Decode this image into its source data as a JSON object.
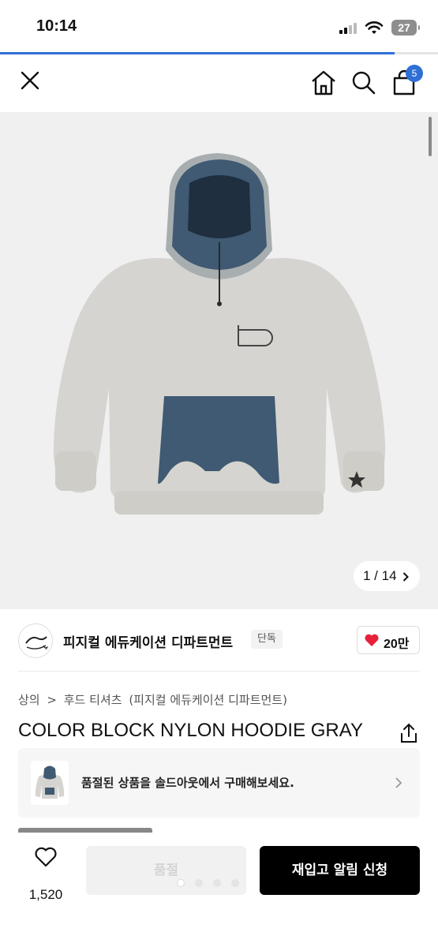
{
  "status": {
    "time": "10:14",
    "battery": "27"
  },
  "nav": {
    "cart_count": "5",
    "icons": [
      "close-icon",
      "home-icon",
      "search-icon",
      "cart-icon"
    ]
  },
  "page_progress": 0.9,
  "gallery": {
    "counter": "1 / 14"
  },
  "brand": {
    "name": "피지컬 에듀케이션 디파트먼트",
    "tag": "단독",
    "likes": "20만"
  },
  "breadcrumb": [
    "상의",
    ">",
    "후드 티셔츠",
    "(피지컬 에듀케이션 디파트먼트)"
  ],
  "product": {
    "title": "COLOR BLOCK NYLON HOODIE GRAY"
  },
  "soldout_card": {
    "text": "품절된 상품을 솔드아웃에서 구매해보세요."
  },
  "bottom": {
    "wish_count": "1,520",
    "soldout_label": "품절",
    "restock_label": "재입고 알림 신청"
  },
  "colors": {
    "accent": "#2f6fd6",
    "heart": "#e8213b",
    "hoodie_gray": "#d5d4d0",
    "nylon_navy": "#3f5a72"
  }
}
